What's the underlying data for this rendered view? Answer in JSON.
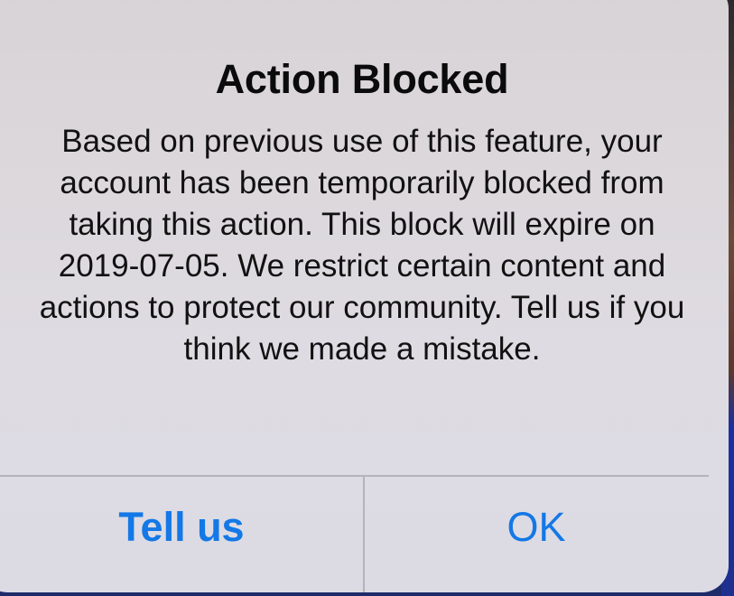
{
  "alert": {
    "title": "Action Blocked",
    "message": "Based on previous use of this feature, your account has been temporarily blocked from taking this action. This block will expire on 2019-07-05. We restrict certain content and actions to protect our community. Tell us if you think we made a mistake.",
    "buttons": {
      "tell_us": "Tell us",
      "ok": "OK"
    }
  },
  "colors": {
    "button_text": "#1478e6",
    "alert_background": "#dcd8dc",
    "title_text": "#0b0b0b"
  }
}
